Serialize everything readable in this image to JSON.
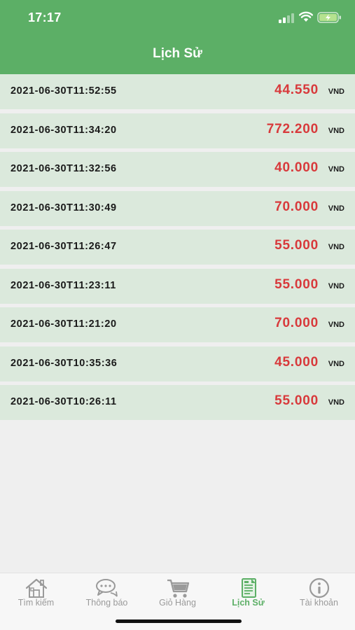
{
  "status_bar": {
    "time": "17:17"
  },
  "header": {
    "title": "Lịch Sử"
  },
  "history": [
    {
      "datetime": "2021-06-30T11:52:55",
      "amount": "44.550",
      "unit": "VND"
    },
    {
      "datetime": "2021-06-30T11:34:20",
      "amount": "772.200",
      "unit": "VND"
    },
    {
      "datetime": "2021-06-30T11:32:56",
      "amount": "40.000",
      "unit": "VND"
    },
    {
      "datetime": "2021-06-30T11:30:49",
      "amount": "70.000",
      "unit": "VND"
    },
    {
      "datetime": "2021-06-30T11:26:47",
      "amount": "55.000",
      "unit": "VND"
    },
    {
      "datetime": "2021-06-30T11:23:11",
      "amount": "55.000",
      "unit": "VND"
    },
    {
      "datetime": "2021-06-30T11:21:20",
      "amount": "70.000",
      "unit": "VND"
    },
    {
      "datetime": "2021-06-30T10:35:36",
      "amount": "45.000",
      "unit": "VND"
    },
    {
      "datetime": "2021-06-30T10:26:11",
      "amount": "55.000",
      "unit": "VND"
    }
  ],
  "tabs": [
    {
      "label": "Tìm kiếm",
      "icon": "home-icon"
    },
    {
      "label": "Thông báo",
      "icon": "chat-bubbles-icon"
    },
    {
      "label": "Giỏ Hàng",
      "icon": "cart-icon"
    },
    {
      "label": "Lịch Sử",
      "icon": "receipt-icon",
      "active": true
    },
    {
      "label": "Tài khoản",
      "icon": "info-icon"
    }
  ],
  "colors": {
    "header_bg": "#5caf66",
    "row_bg": "#dbe9dc",
    "amount": "#d8393b",
    "tab_active": "#5caf66",
    "tab_inactive": "#9a9a9a"
  }
}
